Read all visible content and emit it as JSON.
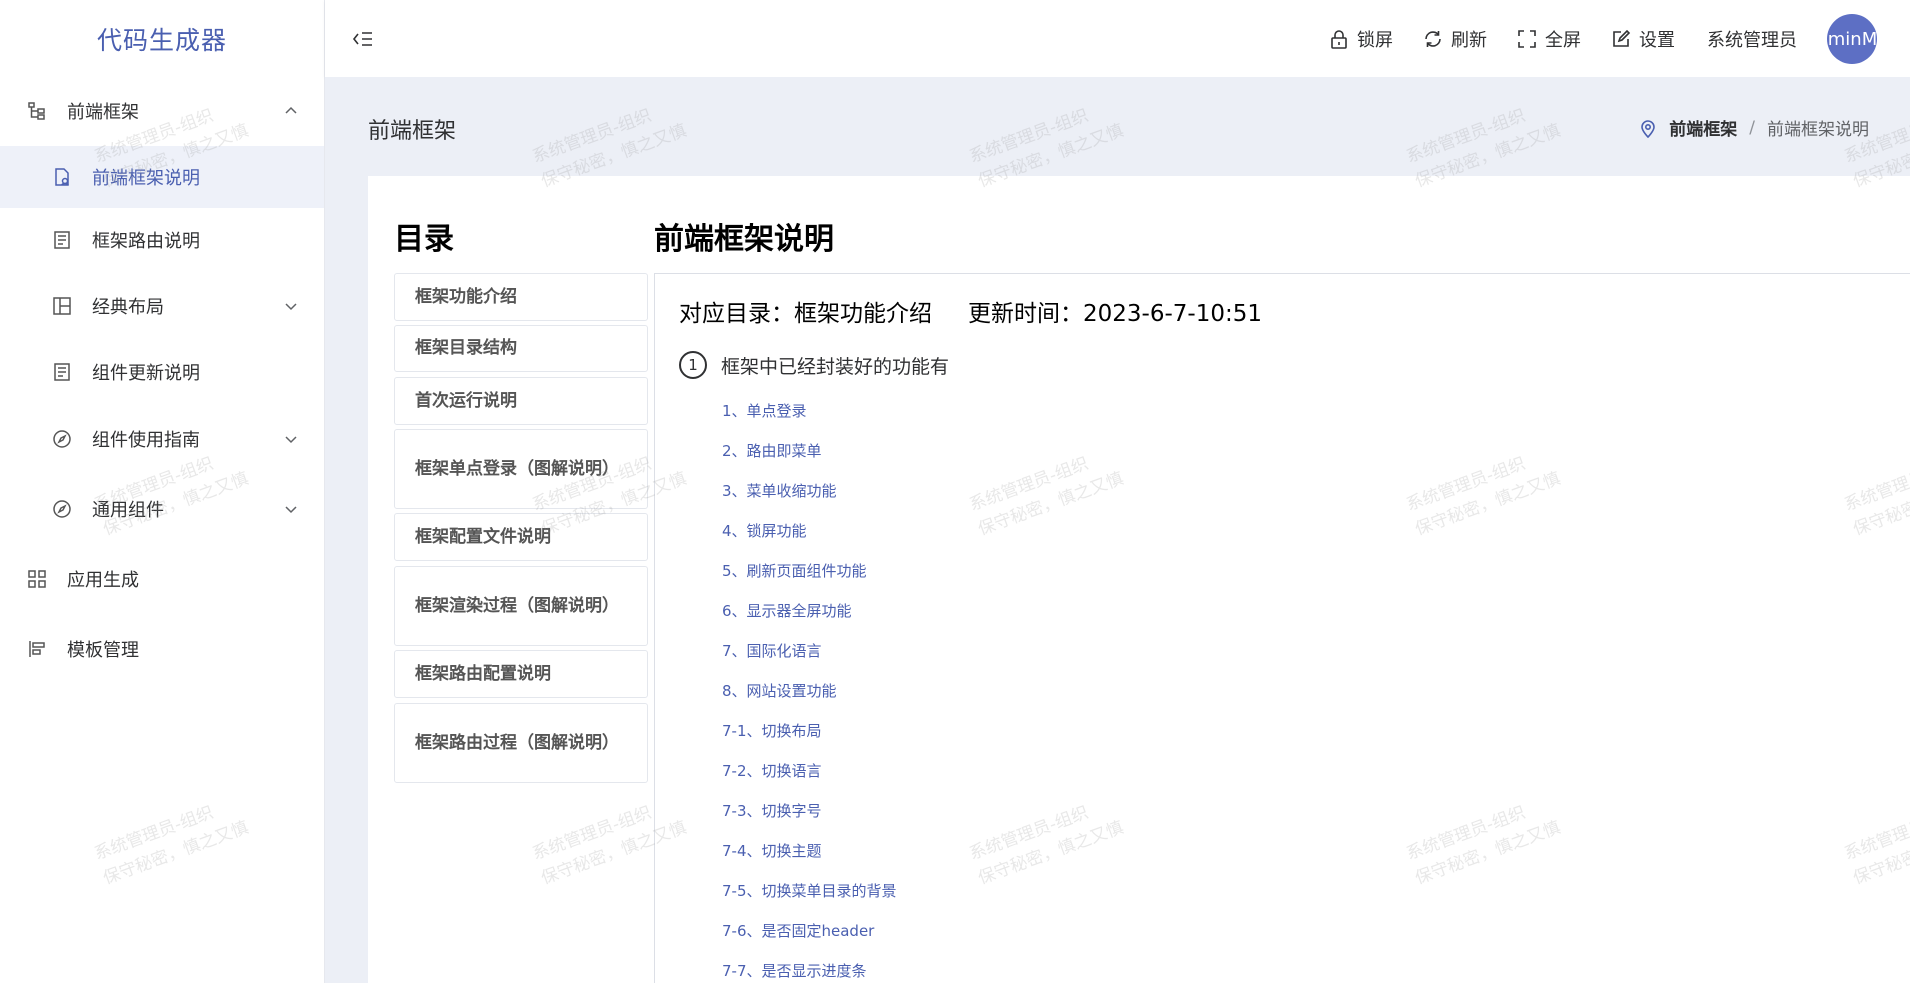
{
  "app": {
    "title": "代码生成器"
  },
  "sidebar": {
    "items": [
      {
        "label": "前端框架",
        "icon": "tree-icon",
        "level": 1,
        "expanded": true
      },
      {
        "label": "前端框架说明",
        "icon": "document-user-icon",
        "level": 2,
        "active": true
      },
      {
        "label": "框架路由说明",
        "icon": "document-list-icon",
        "level": 2
      },
      {
        "label": "经典布局",
        "icon": "layout-icon",
        "level": 2,
        "expandable": true
      },
      {
        "label": "组件更新说明",
        "icon": "document-list-icon",
        "level": 2
      },
      {
        "label": "组件使用指南",
        "icon": "compass-icon",
        "level": 2,
        "expandable": true
      },
      {
        "label": "通用组件",
        "icon": "compass-icon",
        "level": 2,
        "expandable": true
      },
      {
        "label": "应用生成",
        "icon": "grid-icon",
        "level": 1
      },
      {
        "label": "模板管理",
        "icon": "template-icon",
        "level": 1
      }
    ]
  },
  "header": {
    "lock": "锁屏",
    "refresh": "刷新",
    "fullscreen": "全屏",
    "settings": "设置",
    "username": "系统管理员",
    "avatar_text": "AdminMan"
  },
  "page": {
    "title": "前端框架",
    "breadcrumb": [
      "前端框架",
      "前端框架说明"
    ]
  },
  "toc": {
    "title": "目录",
    "items": [
      "框架功能介绍",
      "框架目录结构",
      "首次运行说明",
      "框架单点登录（图解说明）",
      "框架配置文件说明",
      "框架渲染过程（图解说明）",
      "框架路由配置说明",
      "框架路由过程（图解说明）"
    ]
  },
  "doc": {
    "title": "前端框架说明",
    "catalog": "对应目录：框架功能介绍",
    "updated": "更新时间：2023-6-7-10:51",
    "section_num": "1",
    "section_title": "框架中已经封装好的功能有",
    "features": [
      "1、单点登录",
      "2、路由即菜单",
      "3、菜单收缩功能",
      "4、锁屏功能",
      "5、刷新页面组件功能",
      "6、显示器全屏功能",
      "7、国际化语言",
      "8、网站设置功能",
      "7-1、切换布局",
      "7-2、切换语言",
      "7-3、切换字号",
      "7-4、切换主题",
      "7-5、切换菜单目录的背景",
      "7-6、是否固定header",
      "7-7、是否显示进度条"
    ]
  },
  "watermark": {
    "line1": "系统管理员-组织",
    "line2": "保守秘密，慎之又慎"
  },
  "colors": {
    "accent": "#4a5fb0",
    "main_bg": "#eceff6",
    "active_bg": "#eef1f9"
  }
}
